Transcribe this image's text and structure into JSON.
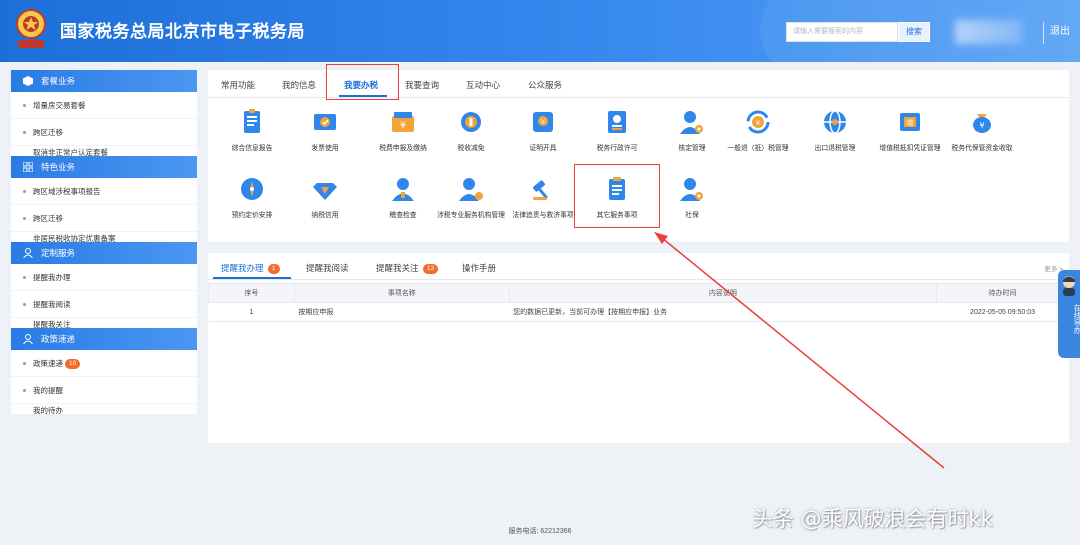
{
  "header": {
    "title": "国家税务总局北京市电子税务局",
    "search_placeholder": "请输入需要搜索的内容",
    "search_button": "搜索",
    "logout": "退出"
  },
  "sidebar": [
    {
      "title": "套餐业务",
      "icon": "cube-icon",
      "items": [
        "增量房交易套餐",
        "跨区迁移",
        "取消非正常户认定套餐"
      ]
    },
    {
      "title": "特色业务",
      "icon": "grid-icon",
      "items": [
        "跨区域涉税事项报告",
        "跨区迁移",
        "非居民税收协定优惠备案"
      ]
    },
    {
      "title": "定制服务",
      "icon": "person-icon",
      "items": [
        "提醒我办理",
        "提醒我阅读",
        "提醒我关注"
      ]
    },
    {
      "title": "政策速递",
      "icon": "person-icon",
      "items": [
        "政策速递",
        "我的提醒",
        "我的待办"
      ],
      "badge": "10"
    }
  ],
  "tabs": [
    "常用功能",
    "我的信息",
    "我要办税",
    "我要查询",
    "互动中心",
    "公众服务"
  ],
  "active_tab": "我要办税",
  "functions": [
    {
      "label": "综合信息报告",
      "icon": "document-icon"
    },
    {
      "label": "发票使用",
      "icon": "ticket-icon"
    },
    {
      "label": "税费申报及缴纳",
      "icon": "wallet-icon"
    },
    {
      "label": "税收减免",
      "icon": "coin-icon"
    },
    {
      "label": "证明开具",
      "icon": "certificate-icon"
    },
    {
      "label": "税务行政许可",
      "icon": "id-card-icon"
    },
    {
      "label": "核定管理",
      "icon": "user-gear-icon"
    },
    {
      "label": "一般退（抵）税管理",
      "icon": "refund-icon"
    },
    {
      "label": "出口退税管理",
      "icon": "globe-icon"
    },
    {
      "label": "增值税抵扣凭证管理",
      "icon": "stamp-icon"
    },
    {
      "label": "税务代保管资金收取",
      "icon": "money-bag-icon"
    },
    {
      "label": "预约定价安排",
      "icon": "compass-icon"
    },
    {
      "label": "纳税信用",
      "icon": "diamond-icon"
    },
    {
      "label": "稽查检查",
      "icon": "inspector-icon"
    },
    {
      "label": "涉税专业服务机构管理",
      "icon": "agent-icon"
    },
    {
      "label": "法律追责与救济事项",
      "icon": "gavel-icon"
    },
    {
      "label": "其它服务事项",
      "icon": "clipboard-icon"
    },
    {
      "label": "社保",
      "icon": "user-gear-icon"
    }
  ],
  "bottom_tabs": [
    {
      "label": "提醒我办理",
      "badge": "1"
    },
    {
      "label": "提醒我阅读",
      "badge": ""
    },
    {
      "label": "提醒我关注",
      "badge": "13"
    },
    {
      "label": "操作手册",
      "badge": ""
    }
  ],
  "more": "更多 >",
  "table": {
    "headers": [
      "序号",
      "事项名称",
      "内容说明",
      "待办时间"
    ],
    "rows": [
      [
        "1",
        "按期应申报",
        "您的数据已更新，当前可办理【按期应申报】业务",
        "2022-05-05 09:50:03"
      ]
    ]
  },
  "footer": "服务电话: 62212366",
  "help_label": "在线导办",
  "watermark": "头条 @乘风破浪会有时kk",
  "colors": {
    "brand": "#1c6fd8",
    "highlight": "#e8413a",
    "badge": "#f26b2a"
  }
}
